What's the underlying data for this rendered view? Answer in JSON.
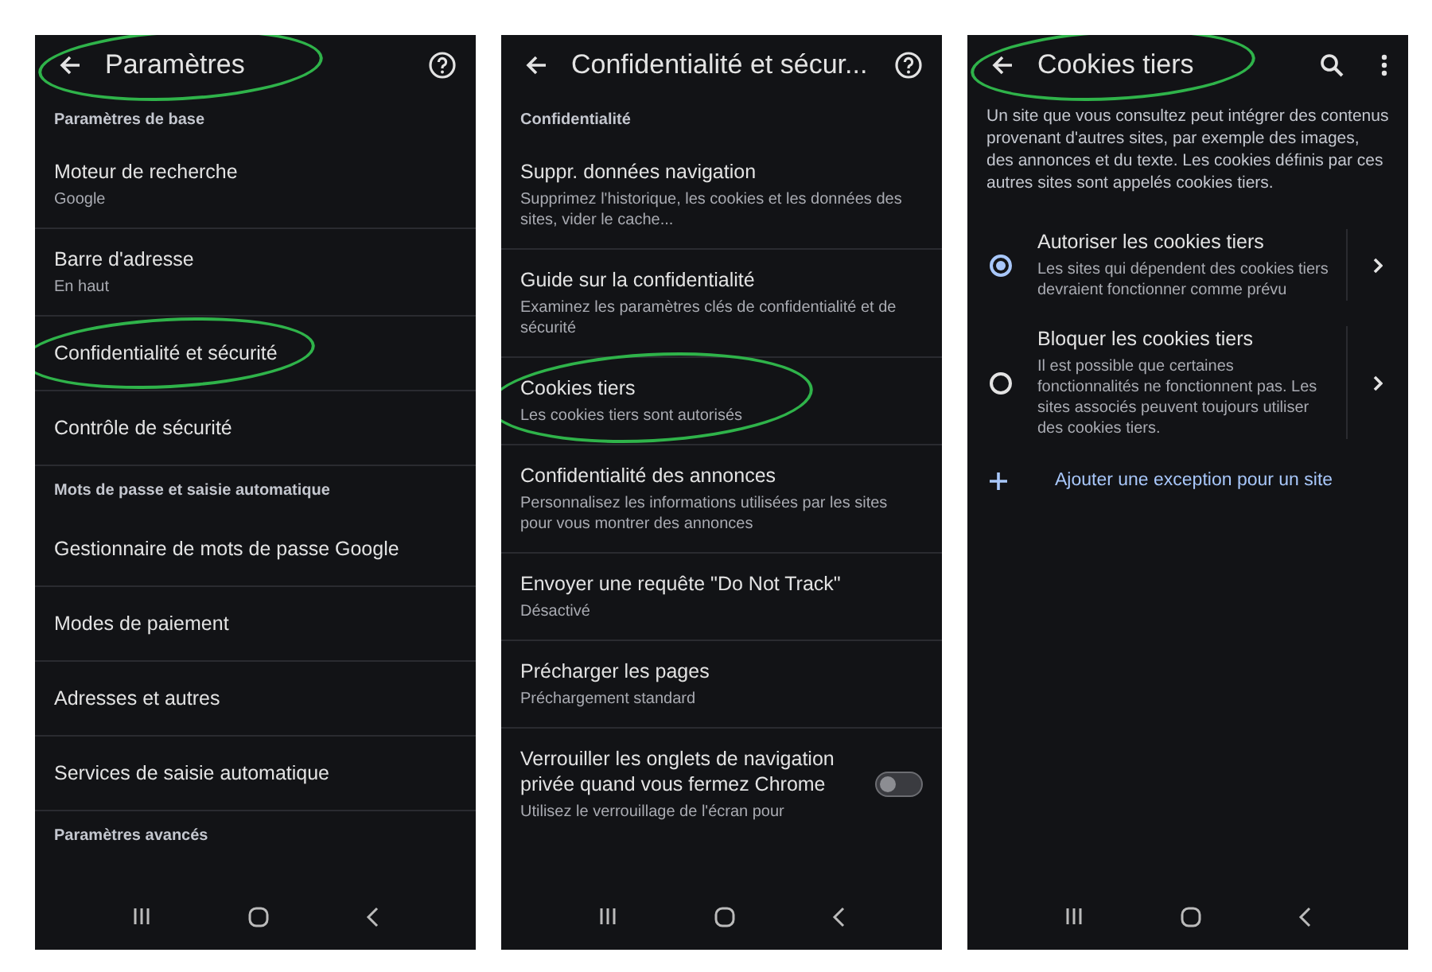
{
  "screens": [
    {
      "kind": "list",
      "title": "Paramètres",
      "title_circled": true,
      "items": [
        {
          "kind": "section",
          "label": "Paramètres de base"
        },
        {
          "kind": "item",
          "title": "Moteur de recherche",
          "subtitle": "Google",
          "circled": false
        },
        {
          "kind": "item",
          "title": "Barre d'adresse",
          "subtitle": "En haut",
          "circled": false
        },
        {
          "kind": "item",
          "title": "Confidentialité et sécurité",
          "circled": true
        },
        {
          "kind": "item",
          "title": "Contrôle de sécurité",
          "circled": false
        },
        {
          "kind": "section",
          "label": "Mots de passe et saisie automatique"
        },
        {
          "kind": "item",
          "title": "Gestionnaire de mots de passe Google",
          "circled": false
        },
        {
          "kind": "item",
          "title": "Modes de paiement",
          "circled": false
        },
        {
          "kind": "item",
          "title": "Adresses et autres",
          "circled": false
        },
        {
          "kind": "item",
          "title": "Services de saisie automatique",
          "circled": false
        },
        {
          "kind": "section",
          "label": "Paramètres avancés"
        }
      ]
    },
    {
      "kind": "list",
      "title": "Confidentialité et sécur...",
      "title_circled": false,
      "items": [
        {
          "kind": "section",
          "label": "Confidentialité"
        },
        {
          "kind": "item",
          "title": "Suppr. données navigation",
          "subtitle": "Supprimez l'historique, les cookies et les données des sites, vider le cache...",
          "circled": false
        },
        {
          "kind": "item",
          "title": "Guide sur la confidentialité",
          "subtitle": "Examinez les paramètres clés de confidentialité et de sécurité",
          "circled": false
        },
        {
          "kind": "item",
          "title": "Cookies tiers",
          "subtitle": "Les cookies tiers sont autorisés",
          "circled": true
        },
        {
          "kind": "item",
          "title": "Confidentialité des annonces",
          "subtitle": "Personnalisez les informations utilisées par les sites pour vous montrer des annonces",
          "circled": false
        },
        {
          "kind": "item",
          "title": "Envoyer une requête \"Do Not Track\"",
          "subtitle": "Désactivé",
          "circled": false
        },
        {
          "kind": "item",
          "title": "Précharger les pages",
          "subtitle": "Préchargement standard",
          "circled": false
        },
        {
          "kind": "toggle",
          "title": "Verrouiller les onglets de navigation privée quand vous fermez Chrome",
          "subtitle": "Utilisez le verrouillage de l'écran pour",
          "on": false,
          "circled": false
        }
      ]
    },
    {
      "kind": "cookies",
      "title": "Cookies tiers",
      "title_circled": true,
      "description": "Un site que vous consultez peut intégrer des contenus provenant d'autres sites, par exemple des images, des annonces et du texte. Les cookies définis par ces autres sites sont appelés cookies tiers.",
      "options": [
        {
          "title": "Autoriser les cookies tiers",
          "description": "Les sites qui dépendent des cookies tiers devraient fonctionner comme prévu",
          "selected": true
        },
        {
          "title": "Bloquer les cookies tiers",
          "description": "Il est possible que certaines fonctionnalités ne fonctionnent pas. Les sites associés peuvent toujours utiliser des cookies tiers.",
          "selected": false
        }
      ],
      "add_exception": {
        "label": "Ajouter une exception pour un site"
      }
    }
  ]
}
